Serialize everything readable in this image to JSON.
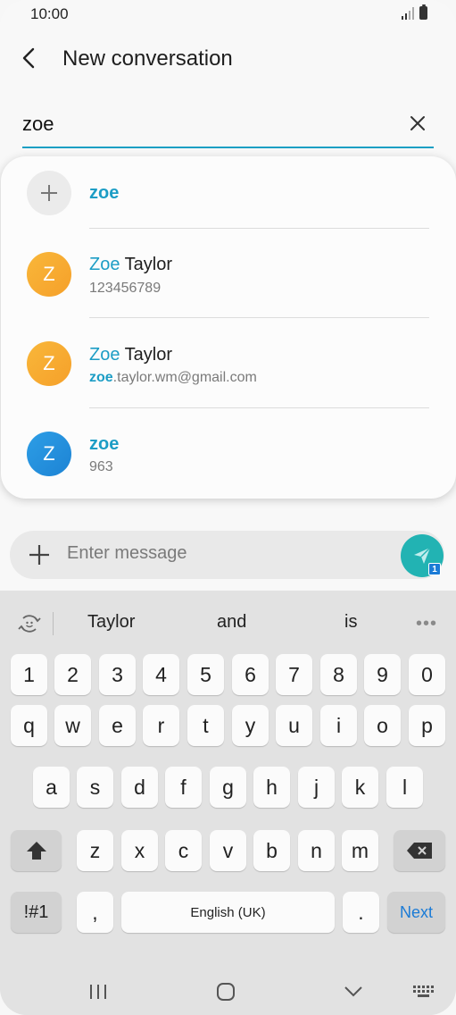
{
  "status_bar": {
    "time": "10:00"
  },
  "header": {
    "title": "New conversation"
  },
  "recipient": {
    "value": "zoe"
  },
  "suggestions": [
    {
      "type": "add",
      "name_highlight": "zoe",
      "name_rest": "",
      "sub_highlight": "",
      "sub_rest": ""
    },
    {
      "type": "contact",
      "avatar_letter": "Z",
      "avatar_color": "#f6a02a",
      "name_highlight": "Zoe",
      "name_rest": " Taylor",
      "sub_highlight": "",
      "sub_rest": "123456789"
    },
    {
      "type": "contact",
      "avatar_letter": "Z",
      "avatar_color": "#f6a02a",
      "name_highlight": "Zoe",
      "name_rest": " Taylor",
      "sub_highlight": "zoe",
      "sub_rest": ".taylor.wm@gmail.com"
    },
    {
      "type": "contact",
      "avatar_letter": "Z",
      "avatar_color": "#1d83d4",
      "name_highlight": "zoe",
      "name_rest": "",
      "sub_highlight": "",
      "sub_rest": "963"
    }
  ],
  "composer": {
    "placeholder": "Enter message",
    "send_badge": "1"
  },
  "keyboard": {
    "predictions": [
      "Taylor",
      "and",
      "is"
    ],
    "more": "•••",
    "row_numbers": [
      "1",
      "2",
      "3",
      "4",
      "5",
      "6",
      "7",
      "8",
      "9",
      "0"
    ],
    "row_top": [
      "q",
      "w",
      "e",
      "r",
      "t",
      "y",
      "u",
      "i",
      "o",
      "p"
    ],
    "row_middle": [
      "a",
      "s",
      "d",
      "f",
      "g",
      "h",
      "j",
      "k",
      "l"
    ],
    "row_bottom": [
      "z",
      "x",
      "c",
      "v",
      "b",
      "n",
      "m"
    ],
    "symbols_key": "!#1",
    "comma_key": ",",
    "space_label": "English (UK)",
    "period_key": ".",
    "next_key": "Next"
  }
}
